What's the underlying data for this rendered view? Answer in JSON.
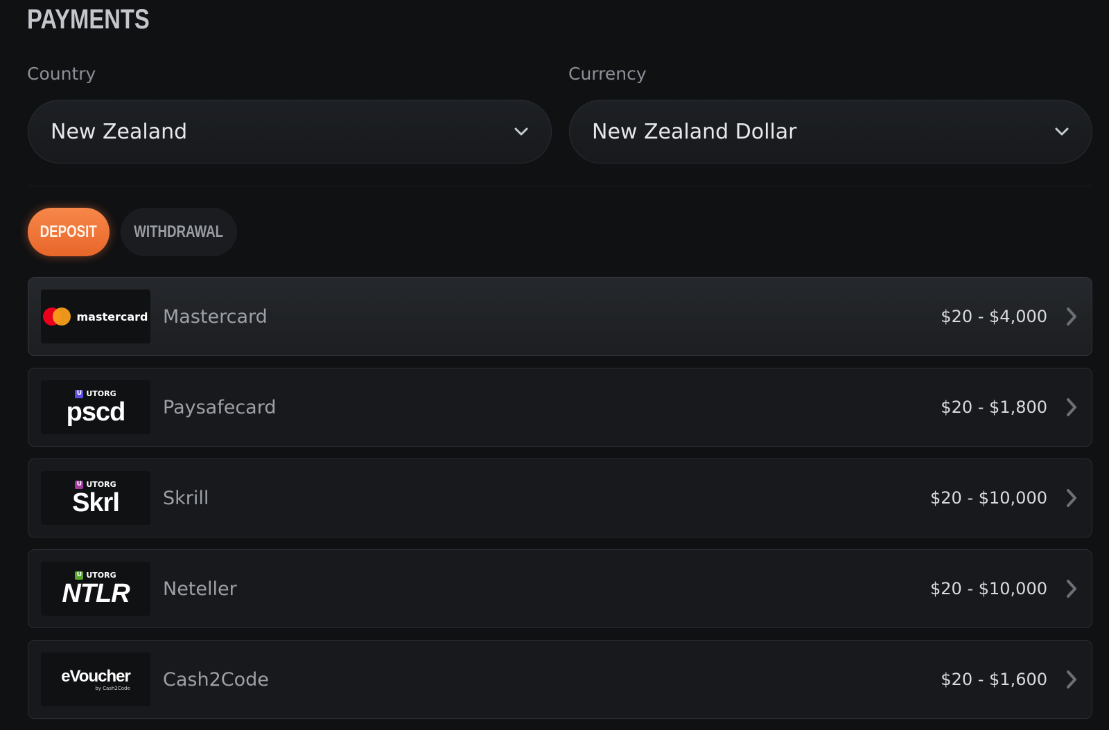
{
  "page": {
    "title": "PAYMENTS"
  },
  "filters": {
    "country": {
      "label": "Country",
      "value": "New Zealand"
    },
    "currency": {
      "label": "Currency",
      "value": "New Zealand Dollar"
    }
  },
  "tabs": [
    {
      "label": "DEPOSIT",
      "active": true
    },
    {
      "label": "WITHDRAWAL",
      "active": false
    }
  ],
  "methods": [
    {
      "name": "Mastercard",
      "range": "$20 - $4,000",
      "logo": {
        "text": "mastercard"
      }
    },
    {
      "name": "Paysafecard",
      "range": "$20 - $1,800",
      "logo": {
        "badge": "U",
        "brand": "UTORG",
        "main": "pscd",
        "badge_color": "#5b4fe0"
      }
    },
    {
      "name": "Skrill",
      "range": "$20 - $10,000",
      "logo": {
        "badge": "U",
        "brand": "UTORG",
        "main": "Skrl",
        "badge_color": "#a13a9c"
      }
    },
    {
      "name": "Neteller",
      "range": "$20 - $10,000",
      "logo": {
        "badge": "U",
        "brand": "UTORG",
        "main": "NTLR",
        "badge_color": "#59a62c"
      }
    },
    {
      "name": "Cash2Code",
      "range": "$20 - $1,600",
      "logo": {
        "main": "eVoucher",
        "sub": "by Cash2Code"
      }
    }
  ],
  "colors": {
    "accent": "#f07a3c",
    "background": "#101113"
  }
}
